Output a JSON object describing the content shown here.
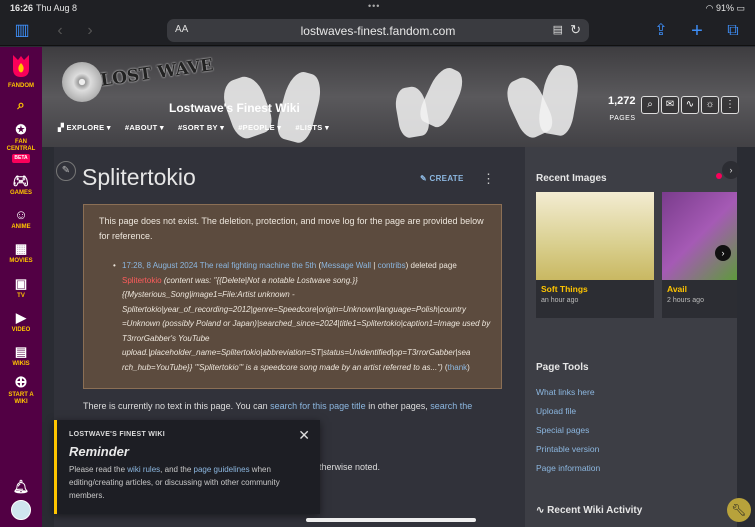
{
  "status": {
    "time": "16:26",
    "date": "Thu Aug 8",
    "battery": "91%"
  },
  "browser": {
    "aa": "AA",
    "url": "lostwaves-finest.fandom.com"
  },
  "global_nav": {
    "brand": "FANDOM",
    "items": [
      {
        "label": "FAN\nCENTRAL",
        "beta": "BETA",
        "icon": "fan-central-icon"
      },
      {
        "label": "GAMES",
        "icon": "games-icon"
      },
      {
        "label": "ANIME",
        "icon": "anime-icon"
      },
      {
        "label": "MOVIES",
        "icon": "movies-icon"
      },
      {
        "label": "TV",
        "icon": "tv-icon"
      },
      {
        "label": "VIDEO",
        "icon": "video-icon"
      },
      {
        "label": "WIKIS",
        "icon": "wikis-icon"
      },
      {
        "label": "START A\nWIKI",
        "icon": "plus-circle-icon"
      }
    ]
  },
  "header": {
    "logo_text": "LOST WAVE",
    "wiki_name": "Lostwave's Finest Wiki",
    "tabs": [
      "EXPLORE",
      "#ABOUT",
      "#SORT BY",
      "#PEOPLE",
      "#LISTS"
    ],
    "page_count": "1,272",
    "page_label": "PAGES"
  },
  "article": {
    "title": "Splitertokio",
    "create": "CREATE",
    "notice_head": "This page does not exist. The deletion, protection, and move log for the page are provided below for reference.",
    "log_time": "17:28, 8 August 2024",
    "log_user": "The real fighting machine the 5th",
    "log_wall": "Message Wall",
    "log_contribs": "contribs",
    "log_action": "deleted page",
    "log_page": "Splitertokio",
    "log_content": "(content was: \"{{Delete|Not a notable Lostwave song.}} {{Mysterious_Song|image1=File:Artist unknown - Splitertokio|year_of_recording=2012|genre=Speedcore|origin=Unknown|language=Polish|country =Unknown (possibly Poland or Japan)|searched_since=2024|title1=Splitertokio|caption1=Image used by T3rrorGabber's YouTube upload.|placeholder_name=Splitertokio|abbreviation=ST|status=Unidentified|op=T3rrorGabber|sea rch_hub=YouTube}} '''Splitertokio''' is a speedcore song made by an artist referred to as...\")",
    "log_thank": "thank",
    "body_prefix": "There is currently no text in this page. You can ",
    "body_link1": "search for this page title",
    "body_mid": " in other pages, ",
    "body_link2": "search the",
    "body_tail": "therwise noted."
  },
  "reminder": {
    "label": "LOSTWAVE'S FINEST WIKI",
    "title": "Reminder",
    "p1": "Please read the ",
    "link1": "wiki rules",
    "p2": ", and the ",
    "link2": "page guidelines",
    "p3": " when editing/creating articles, or discussing with other community members."
  },
  "rail": {
    "recent_images_title": "Recent Images",
    "images": [
      {
        "caption": "Soft Things",
        "when": "an hour ago"
      },
      {
        "caption": "Avail",
        "when": "2 hours ago"
      }
    ],
    "page_tools_title": "Page Tools",
    "tools": [
      "What links here",
      "Upload file",
      "Special pages",
      "Printable version",
      "Page information"
    ],
    "activity_title": "Recent Wiki Activity"
  }
}
